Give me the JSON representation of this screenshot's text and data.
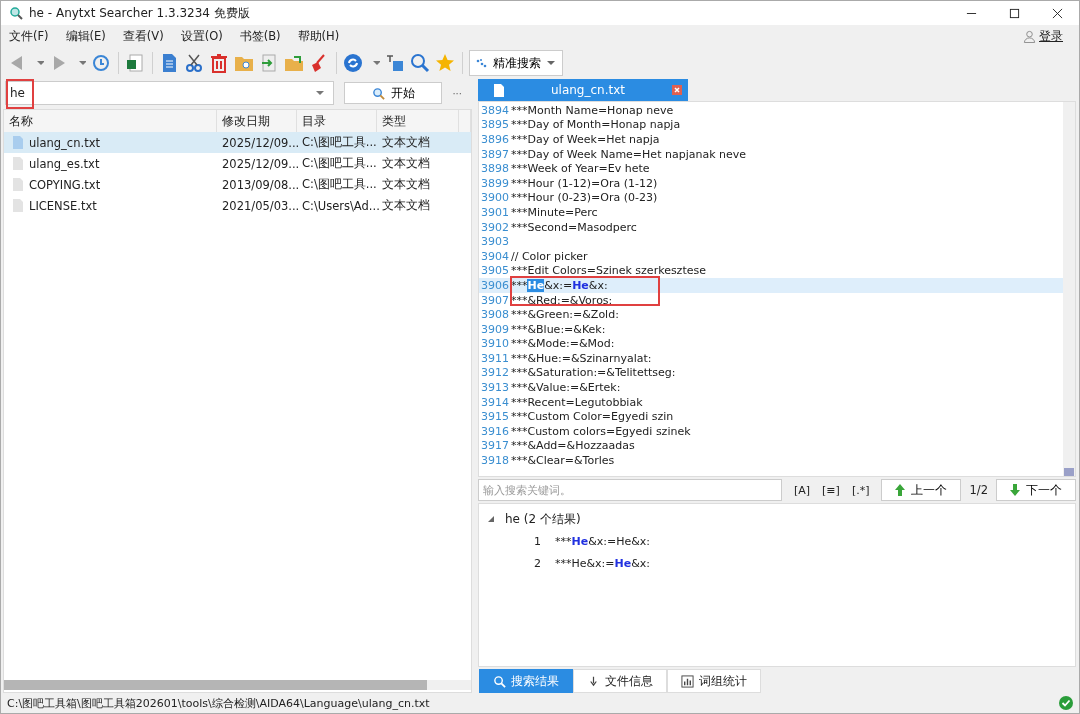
{
  "window": {
    "title": "he - Anytxt Searcher 1.3.3234 免费版"
  },
  "menu": [
    "文件(F)",
    "编辑(E)",
    "查看(V)",
    "设置(O)",
    "书签(B)",
    "帮助(H)"
  ],
  "login": "登录",
  "search_mode": "精准搜索",
  "search": {
    "value": "he",
    "start_button": "开始",
    "more": "···"
  },
  "table": {
    "columns": [
      "名称",
      "修改日期",
      "目录",
      "类型"
    ],
    "rows": [
      {
        "cells": [
          "ulang_cn.txt",
          "2025/12/09...",
          "C:\\图吧工具...",
          "文本文档"
        ],
        "selected": true
      },
      {
        "cells": [
          "ulang_es.txt",
          "2025/12/09...",
          "C:\\图吧工具...",
          "文本文档"
        ],
        "selected": false
      },
      {
        "cells": [
          "COPYING.txt",
          "2013/09/08...",
          "C:\\图吧工具...",
          "文本文档"
        ],
        "selected": false
      },
      {
        "cells": [
          "LICENSE.txt",
          "2021/05/03...",
          "C:\\Users\\Ad...",
          "文本文档"
        ],
        "selected": false
      }
    ]
  },
  "editor": {
    "tab": "ulang_cn.txt",
    "lines": [
      {
        "no": "3894",
        "selected": false,
        "segments": [
          {
            "text": "***Month Name=Honap neve",
            "kind": "plain"
          }
        ]
      },
      {
        "no": "3895",
        "selected": false,
        "segments": [
          {
            "text": "***Day of Month=Honap napja",
            "kind": "plain"
          }
        ]
      },
      {
        "no": "3896",
        "selected": false,
        "segments": [
          {
            "text": "***Day of Week=Het napja",
            "kind": "plain"
          }
        ]
      },
      {
        "no": "3897",
        "selected": false,
        "segments": [
          {
            "text": "***Day of Week Name=Het napjanak neve",
            "kind": "plain"
          }
        ]
      },
      {
        "no": "3898",
        "selected": false,
        "segments": [
          {
            "text": "***Week of Year=Ev hete",
            "kind": "plain"
          }
        ]
      },
      {
        "no": "3899",
        "selected": false,
        "segments": [
          {
            "text": "***Hour (1-12)=Ora (1-12)",
            "kind": "plain"
          }
        ]
      },
      {
        "no": "3900",
        "selected": false,
        "segments": [
          {
            "text": "***Hour (0-23)=Ora (0-23)",
            "kind": "plain"
          }
        ]
      },
      {
        "no": "3901",
        "selected": false,
        "segments": [
          {
            "text": "***Minute=Perc",
            "kind": "plain"
          }
        ]
      },
      {
        "no": "3902",
        "selected": false,
        "segments": [
          {
            "text": "***Second=Masodperc",
            "kind": "plain"
          }
        ]
      },
      {
        "no": "3903",
        "selected": false
      },
      {
        "no": "3904",
        "selected": false,
        "segments": [
          {
            "text": "// Color picker",
            "kind": "plain"
          }
        ]
      },
      {
        "no": "3905",
        "selected": false,
        "segments": [
          {
            "text": "***Edit Colors=Szinek szerkesztese",
            "kind": "plain"
          }
        ]
      },
      {
        "no": "3906",
        "selected": true,
        "segments": [
          {
            "text": "***",
            "kind": "plain"
          },
          {
            "text": "He",
            "kind": "selected"
          },
          {
            "text": "&x:=",
            "kind": "plain"
          },
          {
            "text": "He",
            "kind": "match"
          },
          {
            "text": "&x:",
            "kind": "plain"
          }
        ]
      },
      {
        "no": "3907",
        "selected": false,
        "segments": [
          {
            "text": "***&Red:=&Voros:",
            "kind": "plain"
          }
        ]
      },
      {
        "no": "3908",
        "selected": false,
        "segments": [
          {
            "text": "***&Green:=&Zold:",
            "kind": "plain"
          }
        ]
      },
      {
        "no": "3909",
        "selected": false,
        "segments": [
          {
            "text": "***&Blue:=&Kek:",
            "kind": "plain"
          }
        ]
      },
      {
        "no": "3910",
        "selected": false,
        "segments": [
          {
            "text": "***&Mode:=&Mod:",
            "kind": "plain"
          }
        ]
      },
      {
        "no": "3911",
        "selected": false,
        "segments": [
          {
            "text": "***&Hue:=&Szinarnyalat:",
            "kind": "plain"
          }
        ]
      },
      {
        "no": "3912",
        "selected": false,
        "segments": [
          {
            "text": "***&Saturation:=&Telitettseg:",
            "kind": "plain"
          }
        ]
      },
      {
        "no": "3913",
        "selected": false,
        "segments": [
          {
            "text": "***&Value:=&Ertek:",
            "kind": "plain"
          }
        ]
      },
      {
        "no": "3914",
        "selected": false,
        "segments": [
          {
            "text": "***Recent=Legutobbiak",
            "kind": "plain"
          }
        ]
      },
      {
        "no": "3915",
        "selected": false,
        "segments": [
          {
            "text": "***Custom Color=Egyedi szin",
            "kind": "plain"
          }
        ]
      },
      {
        "no": "3916",
        "selected": false,
        "segments": [
          {
            "text": "***Custom colors=Egyedi szinek",
            "kind": "plain"
          }
        ]
      },
      {
        "no": "3917",
        "selected": false,
        "segments": [
          {
            "text": "***&Add=&Hozzaadas",
            "kind": "plain"
          }
        ]
      },
      {
        "no": "3918",
        "selected": false,
        "segments": [
          {
            "text": "***&Clear=&Torles",
            "kind": "plain"
          }
        ]
      }
    ]
  },
  "find": {
    "placeholder": "输入搜索关键词。",
    "options": [
      "[A]",
      "[≡]",
      "[.*]"
    ],
    "prev": "上一个",
    "count": "1/2",
    "next": "下一个"
  },
  "results": {
    "label": "he (2 个结果)",
    "expanded": true,
    "items": [
      {
        "no": "1",
        "segments": [
          {
            "text": "***",
            "kind": "plain"
          },
          {
            "text": "He",
            "kind": "match"
          },
          {
            "text": "&x:=He&x:",
            "kind": "plain"
          }
        ]
      },
      {
        "no": "2",
        "segments": [
          {
            "text": "***He&x:=",
            "kind": "plain"
          },
          {
            "text": "He",
            "kind": "match"
          },
          {
            "text": "&x:",
            "kind": "plain"
          }
        ]
      }
    ]
  },
  "bottom_tabs": [
    {
      "label": "搜索结果",
      "selected": true
    },
    {
      "label": "文件信息",
      "selected": false
    },
    {
      "label": "词组统计",
      "selected": false
    }
  ],
  "status_bar": {
    "path": "C:\\图吧工具箱\\图吧工具箱202601\\tools\\综合检测\\AIDA64\\Language\\ulang_cn.txt"
  }
}
